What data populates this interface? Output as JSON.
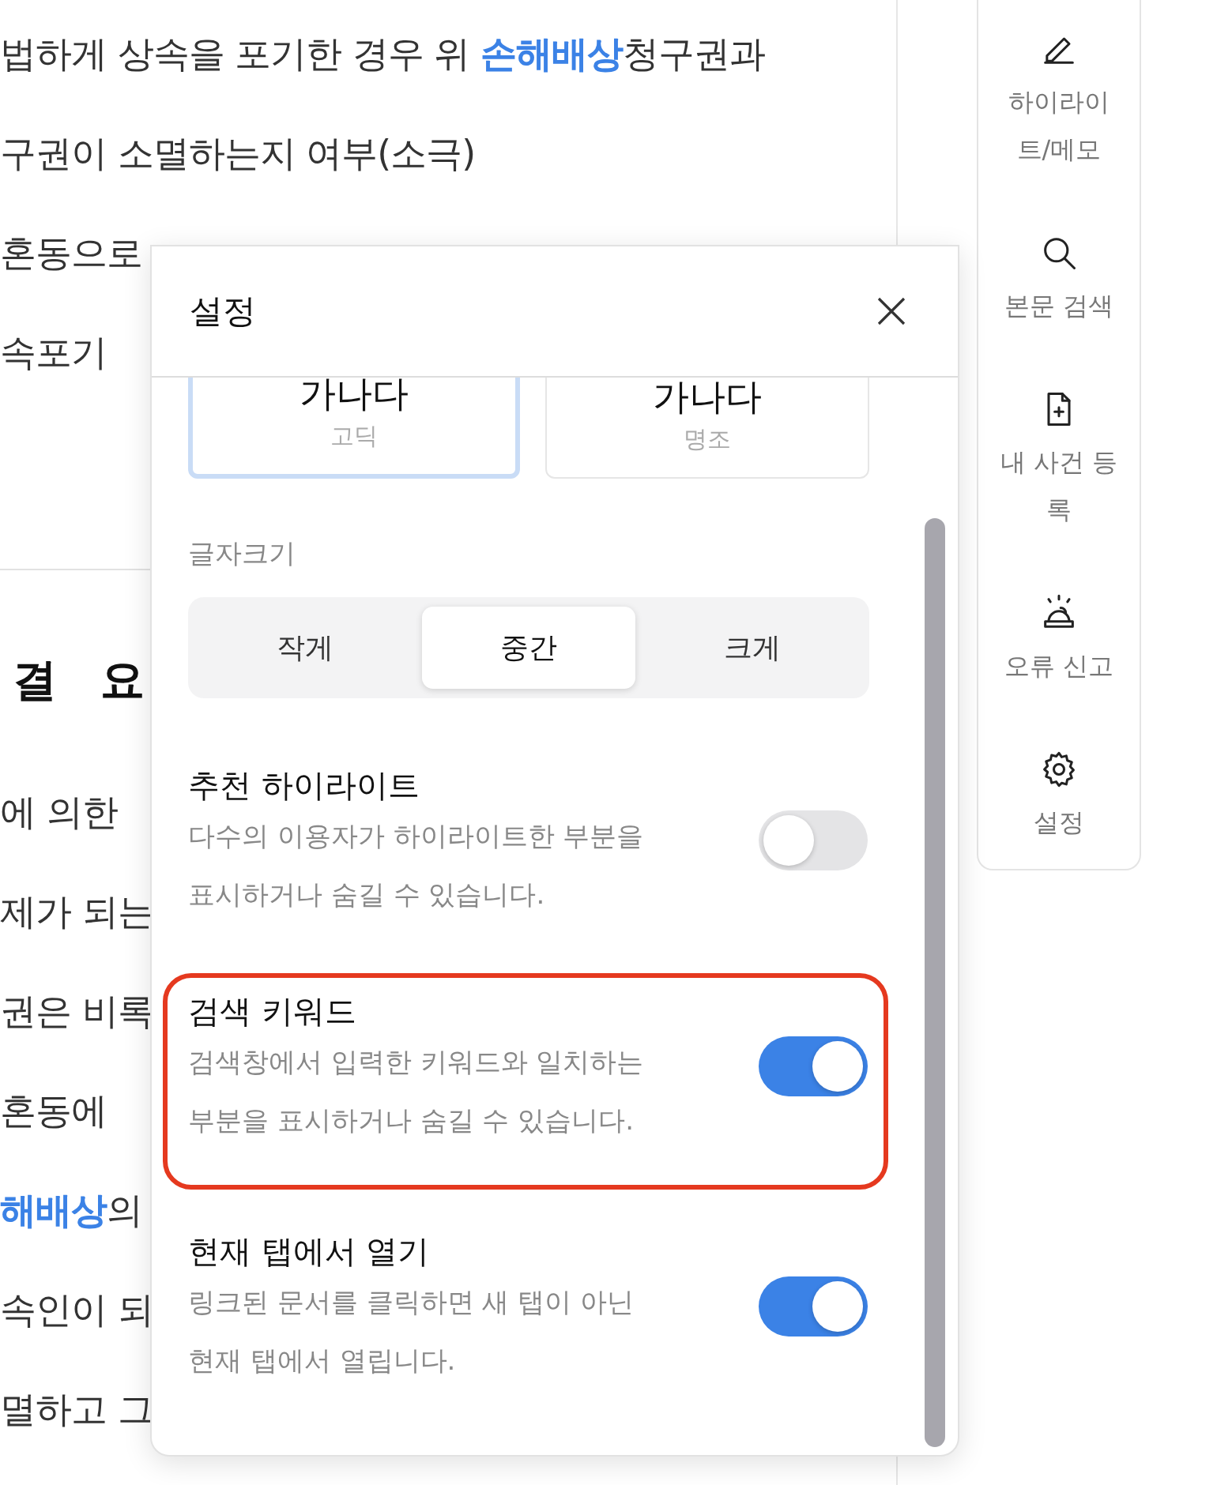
{
  "document": {
    "lines_top": [
      "법하게 상속을 포기한 경우 위 **손해배상**청구권과",
      "구권이 소멸하는지 여부(소극)",
      "혼동으로",
      "속포기"
    ],
    "heading": "결 요",
    "lines_bottom": [
      "에 의한",
      "제가 되는",
      "권은 비록",
      "혼동에",
      "**해배상**의",
      "속인이 되",
      "멸하고 그"
    ]
  },
  "settings_dialog": {
    "title": "설정",
    "font_options": [
      {
        "sample": "가나다",
        "label": "고딕",
        "selected": true
      },
      {
        "sample": "가나다",
        "label": "명조",
        "selected": false
      }
    ],
    "font_size_label": "글자크기",
    "font_sizes": [
      {
        "label": "작게",
        "selected": false
      },
      {
        "label": "중간",
        "selected": true
      },
      {
        "label": "크게",
        "selected": false
      }
    ],
    "toggles": [
      {
        "title": "추천 하이라이트",
        "description": "다수의 이용자가 하이라이트한 부분을 표시하거나 숨길 수 있습니다.",
        "on": false,
        "outlined": false
      },
      {
        "title": "검색 키워드",
        "description": "검색창에서 입력한 키워드와 일치하는 부분을 표시하거나 숨길 수 있습니다.",
        "on": true,
        "outlined": true
      },
      {
        "title": "현재 탭에서 열기",
        "description": "링크된 문서를 클릭하면 새 탭이 아닌 현재 탭에서 열립니다.",
        "on": true,
        "outlined": false
      }
    ]
  },
  "sidebar": {
    "items": [
      {
        "kind": "pencil",
        "label": "하이라이트/메모"
      },
      {
        "kind": "search",
        "label": "본문 검색"
      },
      {
        "kind": "file-plus",
        "label": "내 사건 등록"
      },
      {
        "kind": "siren",
        "label": "오류 신고"
      },
      {
        "kind": "gear",
        "label": "설정"
      }
    ]
  }
}
